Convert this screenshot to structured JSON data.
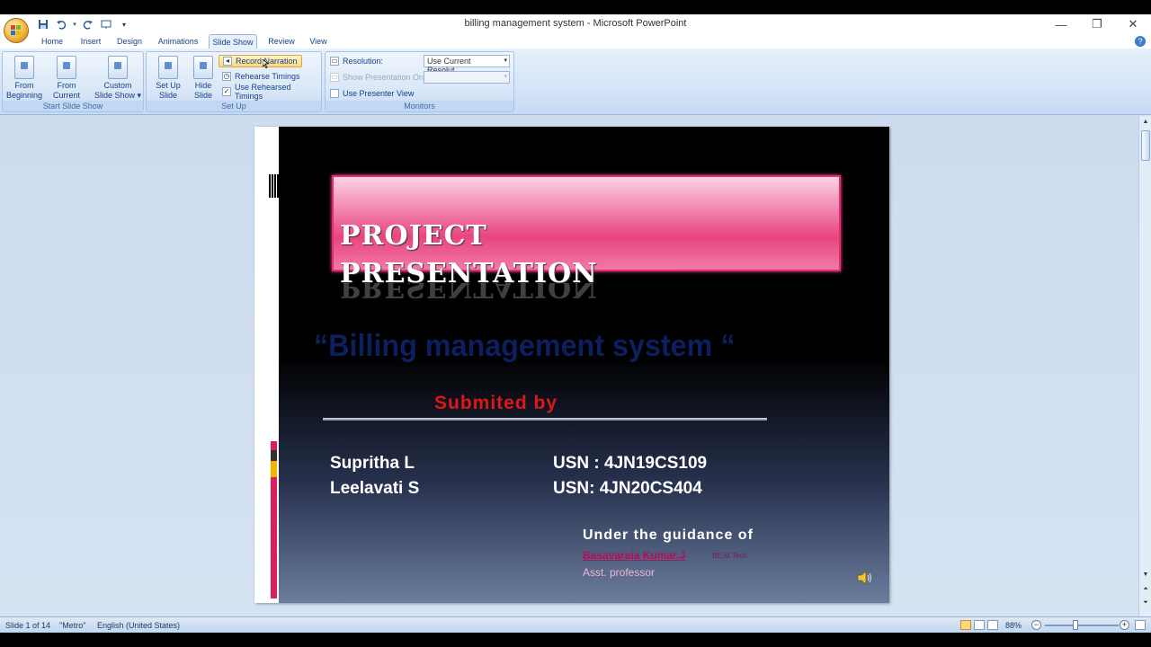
{
  "window": {
    "title": "billing management system - Microsoft PowerPoint",
    "minimize_glyph": "—",
    "restore_glyph": "❐",
    "close_glyph": "✕"
  },
  "quick_access": {
    "save_icon": "save-icon",
    "undo_icon": "undo-icon",
    "redo_icon": "redo-icon",
    "customize_glyph": "▾"
  },
  "tabs": [
    {
      "label": "Home"
    },
    {
      "label": "Insert"
    },
    {
      "label": "Design"
    },
    {
      "label": "Animations"
    },
    {
      "label": "Slide Show",
      "active": true
    },
    {
      "label": "Review"
    },
    {
      "label": "View"
    }
  ],
  "ribbon": {
    "start_group": {
      "label": "Start Slide Show",
      "from_beginning": [
        "From",
        "Beginning"
      ],
      "from_current": [
        "From",
        "Current Slide"
      ],
      "custom": [
        "Custom",
        "Slide Show ▾"
      ]
    },
    "setup_group": {
      "label": "Set Up",
      "setup_show": [
        "Set Up",
        "Slide Show"
      ],
      "hide_slide": [
        "Hide",
        "Slide"
      ],
      "record_narration": "Record Narration",
      "rehearse_timings": "Rehearse Timings",
      "use_rehearsed": "Use Rehearsed Timings",
      "use_rehearsed_checked": true
    },
    "monitors_group": {
      "label": "Monitors",
      "resolution_label": "Resolution:",
      "resolution_value": "Use Current Resolut...",
      "show_on_label": "Show Presentation On:",
      "show_on_value": "",
      "presenter_view": "Use Presenter View",
      "presenter_view_checked": false
    }
  },
  "slide": {
    "title_line1": "PROJECT",
    "title_line2": "PRESENTATION",
    "subtitle": "“Billing management system “",
    "submitted_by": "Submited  by",
    "members": [
      {
        "name": "Supritha L",
        "usn": "USN : 4JN19CS109"
      },
      {
        "name": "Leelavati S",
        "usn": "USN: 4JN20CS404"
      }
    ],
    "guidance_label": "Under the guidance  of",
    "guide_name": "Basavaraja  Kumar.J",
    "guide_quals": "BE,M.Tech",
    "guide_title": "Asst. professor",
    "colors": {
      "banner": "#e9447f",
      "subtitle": "#0d1f5e",
      "submitted": "#e11717",
      "guide_name": "#b10e5c"
    }
  },
  "status": {
    "slide_info": "Slide 1 of 14",
    "theme": "\"Metro\"",
    "language": "English (United States)",
    "zoom": "88%"
  }
}
